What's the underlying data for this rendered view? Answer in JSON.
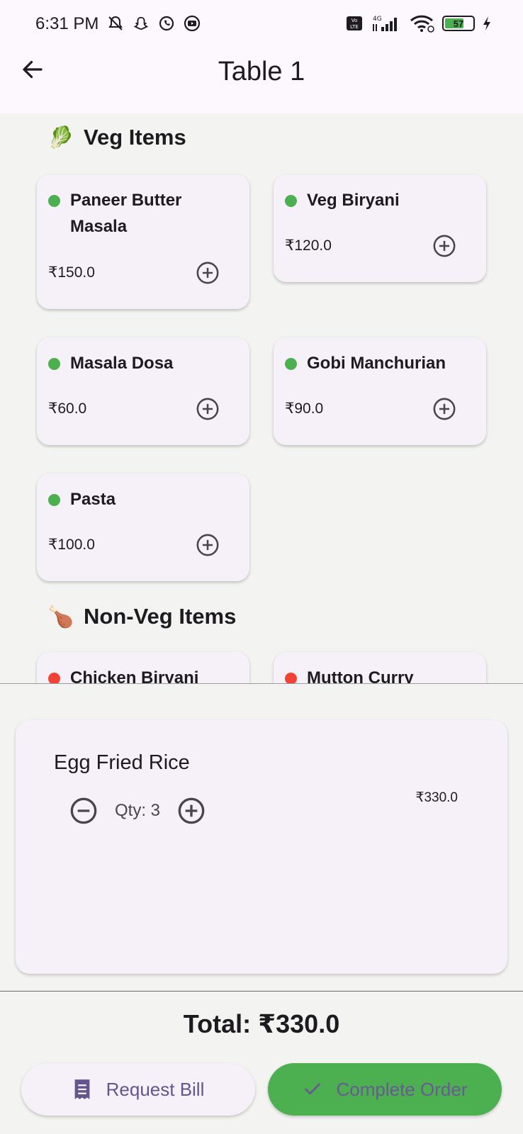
{
  "status_bar": {
    "time": "6:31 PM",
    "battery": "57",
    "left_icons": [
      "mute-alarm-icon",
      "snapchat-icon",
      "whatsapp-icon",
      "youtube-icon"
    ],
    "right_icons": [
      "volte-icon",
      "signal-4g-icon",
      "wifi-icon",
      "battery-icon",
      "charging-icon"
    ]
  },
  "app_bar": {
    "title": "Table 1",
    "back_icon": "arrow-back-icon"
  },
  "sections": {
    "veg": {
      "title": "Veg Items",
      "emoji": "🥬",
      "items": [
        {
          "name": "Paneer Butter Masala",
          "price": "₹150.0"
        },
        {
          "name": "Veg Biryani",
          "price": "₹120.0"
        },
        {
          "name": "Masala Dosa",
          "price": "₹60.0"
        },
        {
          "name": "Gobi Manchurian",
          "price": "₹90.0"
        },
        {
          "name": "Pasta",
          "price": "₹100.0"
        }
      ]
    },
    "nonveg": {
      "title": "Non-Veg Items",
      "emoji": "🍗",
      "items": [
        {
          "name": "Chicken Biryani"
        },
        {
          "name": "Mutton Curry"
        }
      ]
    }
  },
  "order": {
    "items": [
      {
        "name": "Egg Fried Rice",
        "qty_label": "Qty: 3",
        "price": "₹330.0"
      }
    ]
  },
  "total_label": "Total: ₹330.0",
  "actions": {
    "request_bill": "Request Bill",
    "complete_order": "Complete Order"
  },
  "colors": {
    "veg_dot": "#4caf50",
    "nonveg_dot": "#f44336",
    "primary": "#65558f",
    "complete_bg": "#4caf50"
  }
}
